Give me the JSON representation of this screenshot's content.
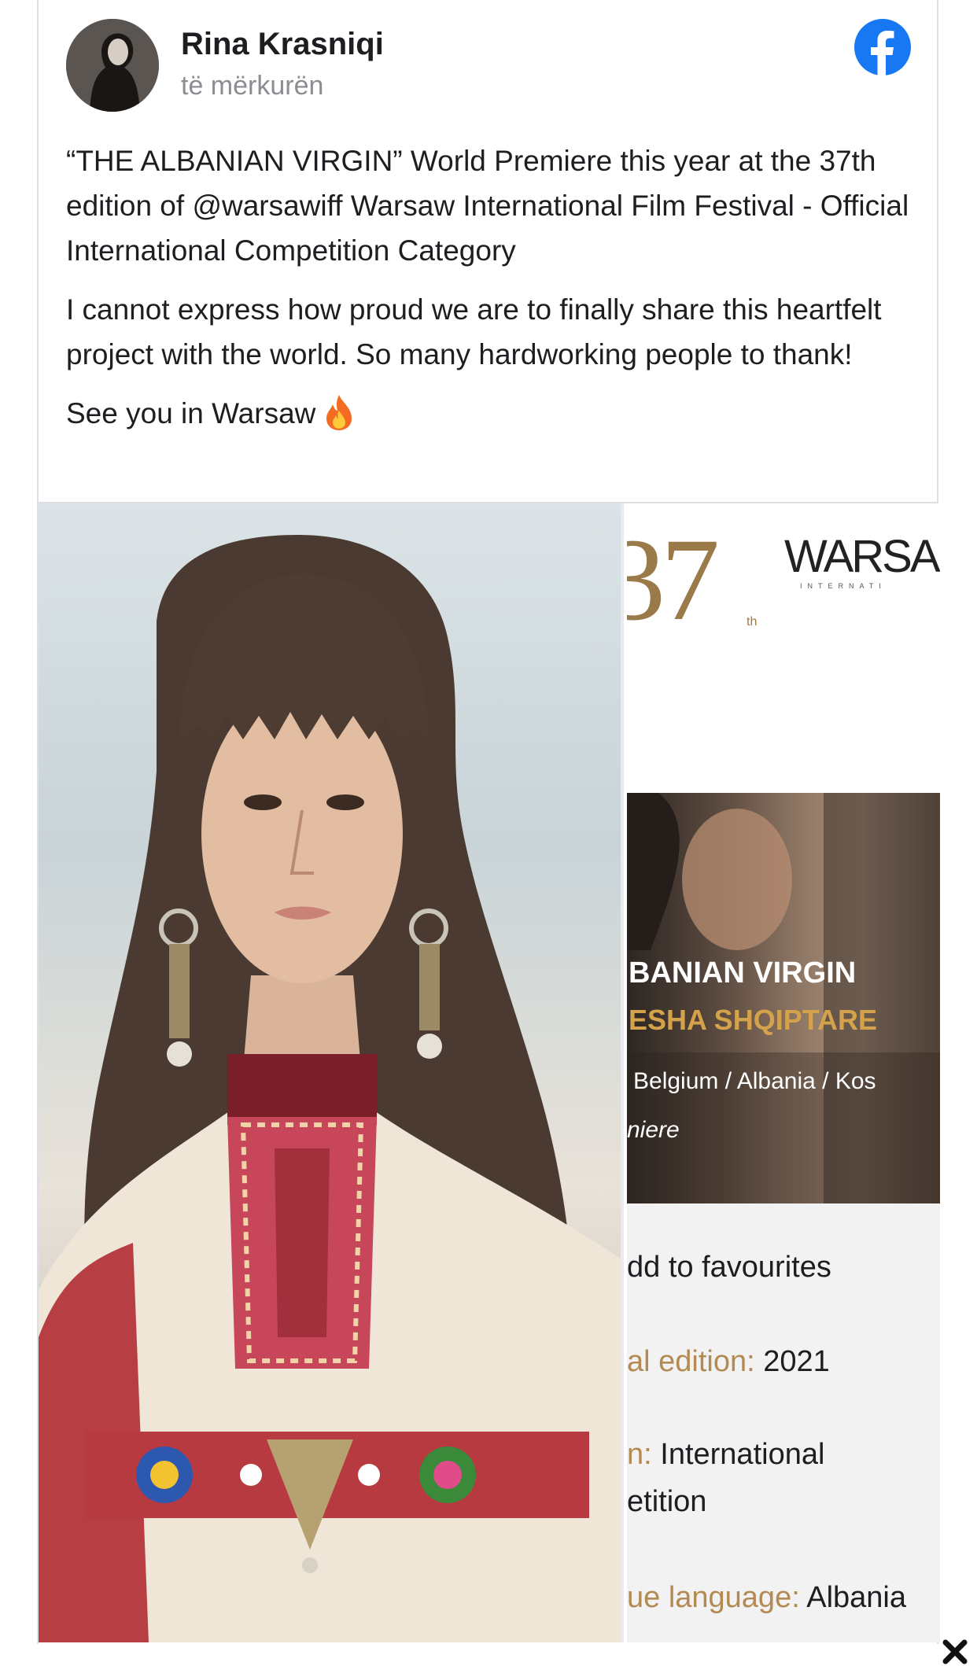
{
  "post": {
    "author_name": "Rina Krasniqi",
    "time": "të mërkurën",
    "paragraphs": [
      "“THE ALBANIAN VIRGIN” World Premiere this year at the 37th edition of @warsawiff Warsaw International Film Festival - Official International Competition Category",
      "I cannot express how proud we are to finally share this heartfelt project with the world. So many hardworking people to thank!",
      "See you in Warsaw"
    ],
    "emoji": "fire-icon"
  },
  "colors": {
    "facebook_blue": "#1877f2",
    "festival_gold": "#9b7a4a",
    "subtitle_gold": "#d4a24a"
  },
  "festival_image": {
    "number": "37",
    "number_suffix": "th",
    "word": "WARSA",
    "subword": "INTERNATI",
    "film_title": "BANIAN VIRGIN",
    "film_subtitle": "ESHA SHQIPTARE",
    "countries": "Belgium / Albania / Kos",
    "premiere": "niere",
    "favourites": "dd to favourites",
    "edition_key": "al edition:",
    "edition_value": "2021",
    "section_key": "n:",
    "section_value_1": "International",
    "section_value_2": "etition",
    "language_key": "ue language:",
    "language_value": "Albania"
  }
}
